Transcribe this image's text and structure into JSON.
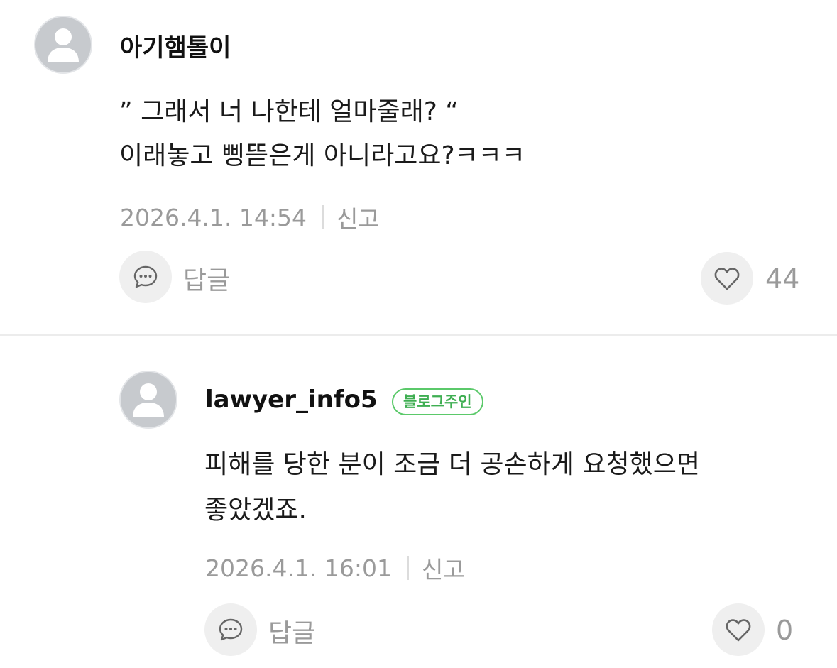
{
  "comments": [
    {
      "nickname": "아기햄톨이",
      "line1": "” 그래서 너 나한테 얼마줄래? “",
      "line2": "이래놓고 삥뜯은게 아니라고요?ㅋㅋㅋ",
      "date": "2026.4.1. 14:54",
      "report_label": "신고",
      "reply_label": "답글",
      "likes": "44"
    },
    {
      "nickname": "lawyer_info5",
      "badge": "블로그주인",
      "line1": "피해를 당한 분이 조금 더 공손하게 요청했으면",
      "line2": "좋았겠죠.",
      "date": "2026.4.1. 16:01",
      "report_label": "신고",
      "reply_label": "답글",
      "likes": "0"
    }
  ],
  "colors": {
    "badge_green": "#3fae52",
    "muted_text": "#9a9a9a",
    "button_bg": "#efefef"
  },
  "icons": [
    "default-avatar-icon",
    "speech-bubble-icon",
    "heart-icon"
  ]
}
